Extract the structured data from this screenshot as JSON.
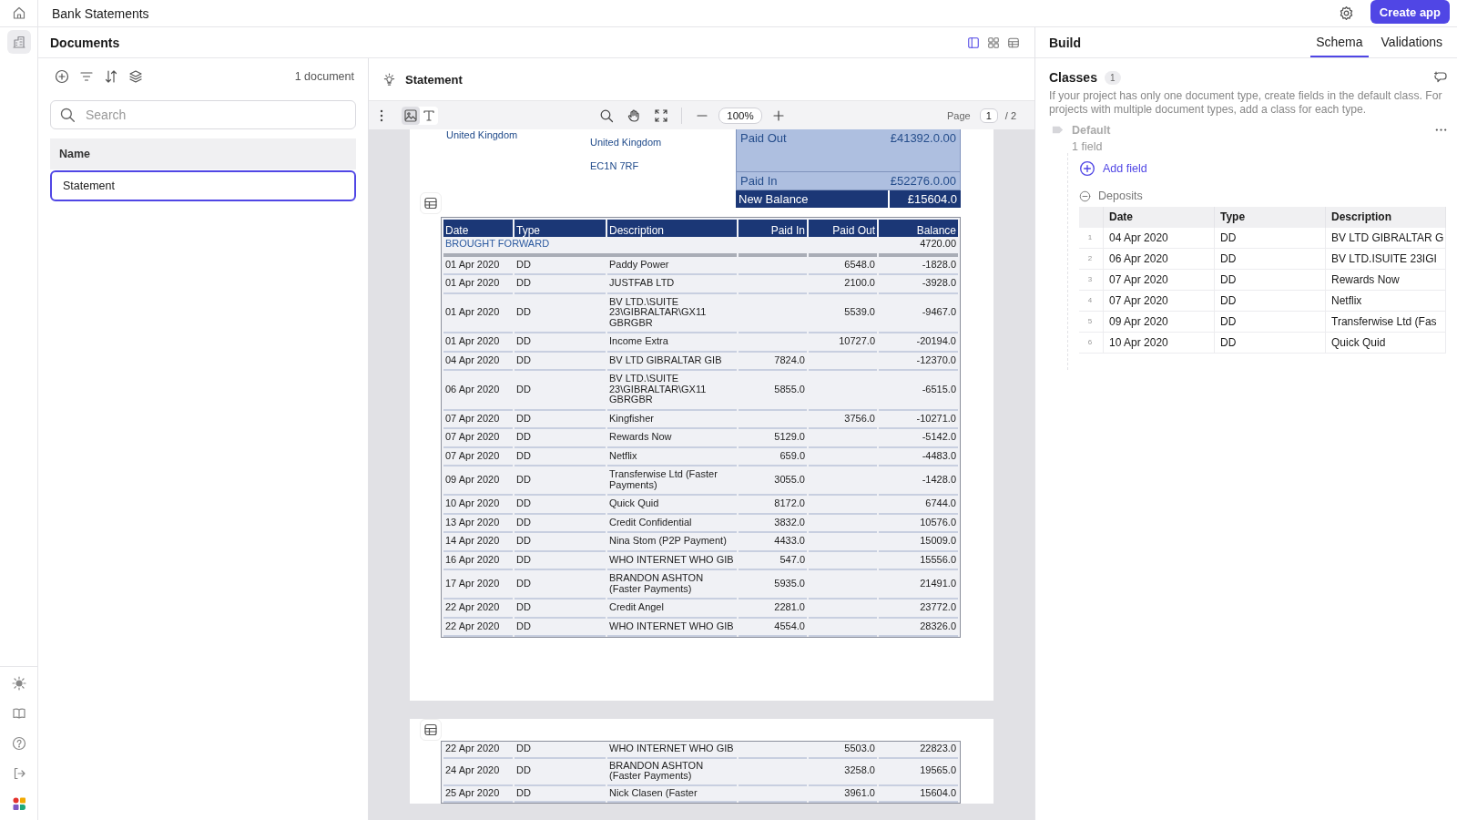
{
  "app_bar": {
    "title": "Bank Statements",
    "create_button": "Create app"
  },
  "rail": [
    {
      "kind": "home",
      "selected": false
    },
    {
      "kind": "building",
      "selected": true
    }
  ],
  "documents_header": {
    "title": "Documents",
    "view_modes": [
      {
        "kind": "split",
        "selected": true
      },
      {
        "kind": "grid",
        "selected": false
      },
      {
        "kind": "table",
        "selected": false
      }
    ]
  },
  "documents_panel": {
    "count": "1 document",
    "search": {
      "placeholder": "Search"
    },
    "columns": [
      "Name"
    ],
    "rows": [
      {
        "name": "Statement",
        "selected": true
      }
    ]
  },
  "viewer": {
    "title": "Statement",
    "modes": [
      {
        "kind": "image",
        "selected": true
      },
      {
        "kind": "text",
        "selected": false
      }
    ],
    "zoom": "100%",
    "page_label": "Page",
    "page": "1",
    "page_total": "/ 2",
    "pages": [
      {
        "address_left": [
          "United Kingdom"
        ],
        "address_right": [
          "United Kingdom",
          "EC1N 7RF"
        ],
        "summary": [
          {
            "kind": "light",
            "label": "Paid Out",
            "value": "£41392.0.00"
          },
          {
            "kind": "light",
            "label": "Paid In",
            "value": "£52276.0.00"
          },
          {
            "kind": "dark",
            "label": "New Balance",
            "value": "£15604.0"
          }
        ],
        "columns": [
          "Date",
          "Type",
          "Description",
          "Paid In",
          "Paid Out",
          "Balance"
        ],
        "brought_forward": {
          "label": "BROUGHT FORWARD",
          "balance": "4720.00"
        },
        "rows": [
          {
            "date": "01 Apr 2020",
            "type": "DD",
            "description": "Paddy Power",
            "paid_out": "6548.0",
            "balance": "-1828.0"
          },
          {
            "date": "01 Apr 2020",
            "type": "DD",
            "description": "JUSTFAB LTD",
            "paid_out": "2100.0",
            "balance": "-3928.0"
          },
          {
            "date": "01 Apr 2020",
            "type": "DD",
            "description": "BV LTD.\\SUITE 23\\GIBRALTAR\\GX11 GBRGBR",
            "paid_out": "5539.0",
            "balance": "-9467.0"
          },
          {
            "date": "01 Apr 2020",
            "type": "DD",
            "description": "Income Extra",
            "paid_out": "10727.0",
            "balance": "-20194.0"
          },
          {
            "date": "04 Apr 2020",
            "type": "DD",
            "description": "BV LTD GIBRALTAR GIB",
            "paid_in": "7824.0",
            "balance": "-12370.0"
          },
          {
            "date": "06 Apr 2020",
            "type": "DD",
            "description": "BV LTD.\\SUITE 23\\GIBRALTAR\\GX11 GBRGBR",
            "paid_in": "5855.0",
            "balance": "-6515.0"
          },
          {
            "date": "07 Apr 2020",
            "type": "DD",
            "description": "Kingfisher",
            "paid_out": "3756.0",
            "balance": "-10271.0"
          },
          {
            "date": "07 Apr 2020",
            "type": "DD",
            "description": "Rewards Now",
            "paid_in": "5129.0",
            "balance": "-5142.0"
          },
          {
            "date": "07 Apr 2020",
            "type": "DD",
            "description": "Netflix",
            "paid_in": "659.0",
            "balance": "-4483.0"
          },
          {
            "date": "09 Apr 2020",
            "type": "DD",
            "description": "Transferwise Ltd (Faster Payments)",
            "paid_in": "3055.0",
            "balance": "-1428.0"
          },
          {
            "date": "10 Apr 2020",
            "type": "DD",
            "description": "Quick Quid",
            "paid_in": "8172.0",
            "balance": "6744.0"
          },
          {
            "date": "13 Apr 2020",
            "type": "DD",
            "description": "Credit Confidential",
            "paid_in": "3832.0",
            "balance": "10576.0"
          },
          {
            "date": "14 Apr 2020",
            "type": "DD",
            "description": "Nina Stom (P2P Payment)",
            "paid_in": "4433.0",
            "balance": "15009.0"
          },
          {
            "date": "16 Apr 2020",
            "type": "DD",
            "description": "WHO INTERNET WHO GIB",
            "paid_in": "547.0",
            "balance": "15556.0"
          },
          {
            "date": "17 Apr 2020",
            "type": "DD",
            "description": "BRANDON ASHTON (Faster Payments)",
            "paid_in": "5935.0",
            "balance": "21491.0"
          },
          {
            "date": "22 Apr 2020",
            "type": "DD",
            "description": "Credit Angel",
            "paid_in": "2281.0",
            "balance": "23772.0"
          },
          {
            "date": "22 Apr 2020",
            "type": "DD",
            "description": "WHO INTERNET WHO GIB",
            "paid_in": "4554.0",
            "balance": "28326.0"
          }
        ]
      },
      {
        "rows": [
          {
            "date": "22 Apr 2020",
            "type": "DD",
            "description": "WHO INTERNET WHO GIB",
            "paid_out": "5503.0",
            "balance": "22823.0"
          },
          {
            "date": "24 Apr 2020",
            "type": "DD",
            "description": "BRANDON ASHTON (Faster Payments)",
            "paid_out": "3258.0",
            "balance": "19565.0"
          },
          {
            "date": "25 Apr 2020",
            "type": "DD",
            "description": "Nick Clasen (Faster",
            "paid_out": "3961.0",
            "balance": "15604.0"
          }
        ]
      }
    ]
  },
  "build_panel": {
    "title": "Build",
    "tabs": [
      {
        "label": "Schema",
        "selected": true
      },
      {
        "label": "Validations",
        "selected": false
      }
    ],
    "classes": {
      "title": "Classes",
      "count": "1",
      "description": "If your project has only one document type, create fields in the default class. For projects with multiple document types, add a class for each type.",
      "items": [
        {
          "name": "Default",
          "field_count": "1 field",
          "add_field": "Add field",
          "fields": [
            {
              "name": "Deposits",
              "expanded": true,
              "columns": [
                "Date",
                "Type",
                "Description"
              ],
              "rows": [
                {
                  "index": "1",
                  "cells": [
                    "04 Apr 2020",
                    "DD",
                    "BV LTD GIBRALTAR G"
                  ]
                },
                {
                  "index": "2",
                  "cells": [
                    "06 Apr 2020",
                    "DD",
                    "BV LTD.ISUITE 23IGI"
                  ]
                },
                {
                  "index": "3",
                  "cells": [
                    "07 Apr 2020",
                    "DD",
                    "Rewards Now"
                  ]
                },
                {
                  "index": "4",
                  "cells": [
                    "07 Apr 2020",
                    "DD",
                    "Netflix"
                  ]
                },
                {
                  "index": "5",
                  "cells": [
                    "09 Apr 2020",
                    "DD",
                    "Transferwise Ltd (Fas"
                  ]
                },
                {
                  "index": "6",
                  "cells": [
                    "10 Apr 2020",
                    "DD",
                    "Quick Quid"
                  ]
                }
              ]
            }
          ]
        }
      ]
    }
  }
}
